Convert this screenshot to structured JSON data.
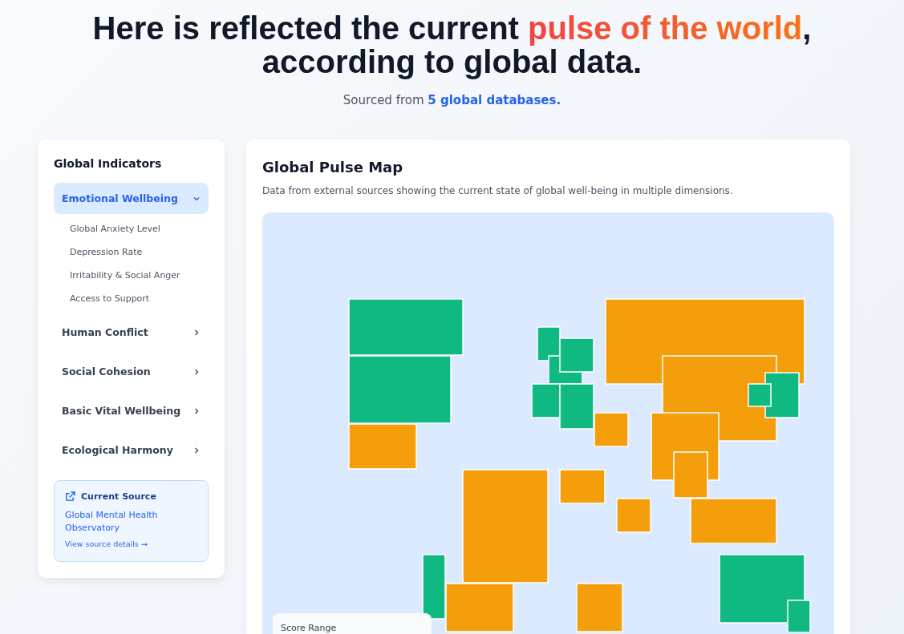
{
  "header": {
    "title_before": "Here is reflected the current ",
    "title_highlight": "pulse of the world",
    "title_after": ", according to global data.",
    "subtitle": "Sourced from **5 global databases.**"
  },
  "sidebar": {
    "title": "Global Indicators",
    "categories": [
      {
        "label": "Emotional Wellbeing",
        "selected": true,
        "expanded": true,
        "children": [
          "Global Anxiety Level",
          "Depression Rate",
          "Irritability & Social Anger",
          "Access to Support"
        ]
      },
      {
        "label": "Human Conflict",
        "selected": false,
        "expanded": false
      },
      {
        "label": "Social Cohesion",
        "selected": false,
        "expanded": false
      },
      {
        "label": "Basic Vital Wellbeing",
        "selected": false,
        "expanded": false
      },
      {
        "label": "Ecological Harmony",
        "selected": false,
        "expanded": false
      }
    ],
    "source": {
      "heading": "Current Source",
      "name": "Global Mental Health Observatory",
      "link": "View source details →"
    }
  },
  "map": {
    "title": "Global Pulse Map",
    "description": "Data from external sources showing the current state of global well-being in multiple dimensions.",
    "regions": [
      {
        "color": "#10b981"
      },
      {
        "color": "#10b981"
      },
      {
        "color": "#f59e0b"
      },
      {
        "color": "#f59e0b"
      },
      {
        "color": "#f59e0b"
      },
      {
        "color": "#10b981"
      },
      {
        "color": "#10b981"
      },
      {
        "color": "#10b981"
      },
      {
        "color": "#10b981"
      },
      {
        "color": "#10b981"
      },
      {
        "color": "#f59e0b"
      },
      {
        "color": "#f59e0b"
      },
      {
        "color": "#f59e0b"
      },
      {
        "color": "#10b981"
      },
      {
        "color": "#10b981"
      },
      {
        "color": "#f59e0b"
      },
      {
        "color": "#f59e0b"
      },
      {
        "color": "#f59e0b"
      },
      {
        "color": "#f59e0b"
      },
      {
        "color": "#10b981"
      },
      {
        "color": "#f59e0b"
      },
      {
        "color": "#f59e0b"
      },
      {
        "color": "#10b981"
      },
      {
        "color": "#10b981"
      }
    ],
    "legend": {
      "title": "Score Range"
    }
  }
}
